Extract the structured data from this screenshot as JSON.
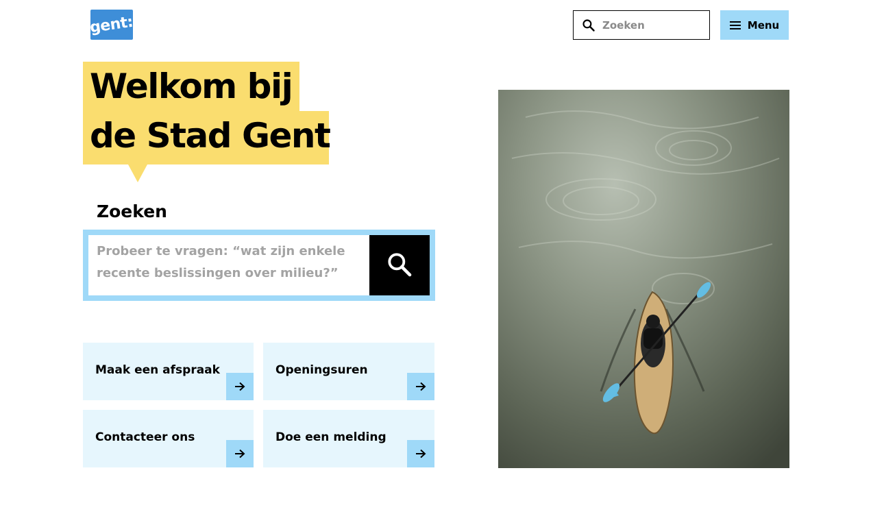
{
  "header": {
    "logo_text": "gent:",
    "search_placeholder": "Zoeken",
    "menu_label": "Menu"
  },
  "hero": {
    "title_line1": "Welkom bij",
    "title_line2": "de Stad Gent"
  },
  "search": {
    "label": "Zoeken",
    "placeholder": "Probeer te vragen: “wat zijn enkele recente beslissingen over milieu?”"
  },
  "quick_links": [
    {
      "label": "Maak een afspraak"
    },
    {
      "label": "Openingsuren"
    },
    {
      "label": "Contacteer ons"
    },
    {
      "label": "Doe een melding"
    }
  ],
  "colors": {
    "brand_blue": "#3e8ed8",
    "accent_light_blue": "#9fd9f8",
    "tile_background": "#e6f6fd",
    "title_yellow": "#fadd6f"
  },
  "icons": {
    "header_search": "search-icon",
    "menu": "hamburger-icon",
    "search_submit": "search-icon",
    "quick_link_arrow": "arrow-right-icon"
  }
}
